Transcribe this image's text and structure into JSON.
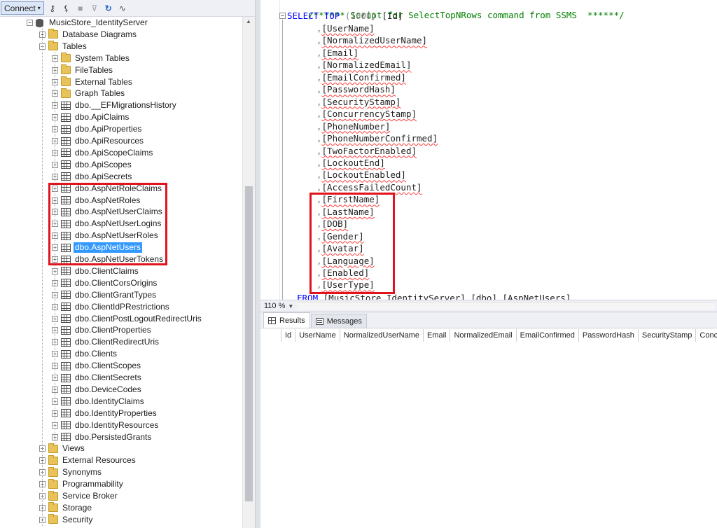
{
  "toolbar": {
    "connect_label": "Connect",
    "connect_arrow": "▾",
    "icons": [
      "connect-server-icon",
      "disconnect-icon",
      "stop-icon",
      "filter-icon",
      "refresh-icon",
      "activity-monitor-icon"
    ]
  },
  "tree": {
    "database": "MusicStore_IdentityServer",
    "folders_top": [
      {
        "label": "Database Diagrams",
        "expander": "+"
      },
      {
        "label": "Tables",
        "expander": "−"
      }
    ],
    "table_subfolders": [
      "System Tables",
      "FileTables",
      "External Tables",
      "Graph Tables"
    ],
    "tables": [
      "dbo.__EFMigrationsHistory",
      "dbo.ApiClaims",
      "dbo.ApiProperties",
      "dbo.ApiResources",
      "dbo.ApiScopeClaims",
      "dbo.ApiScopes",
      "dbo.ApiSecrets",
      "dbo.AspNetRoleClaims",
      "dbo.AspNetRoles",
      "dbo.AspNetUserClaims",
      "dbo.AspNetUserLogins",
      "dbo.AspNetUserRoles",
      "dbo.AspNetUsers",
      "dbo.AspNetUserTokens",
      "dbo.ClientClaims",
      "dbo.ClientCorsOrigins",
      "dbo.ClientGrantTypes",
      "dbo.ClientIdPRestrictions",
      "dbo.ClientPostLogoutRedirectUris",
      "dbo.ClientProperties",
      "dbo.ClientRedirectUris",
      "dbo.Clients",
      "dbo.ClientScopes",
      "dbo.ClientSecrets",
      "dbo.DeviceCodes",
      "dbo.IdentityClaims",
      "dbo.IdentityProperties",
      "dbo.IdentityResources",
      "dbo.PersistedGrants"
    ],
    "selected_table": "dbo.AspNetUsers",
    "folders_bottom": [
      "Views",
      "External Resources",
      "Synonyms",
      "Programmability",
      "Service Broker",
      "Storage",
      "Security"
    ]
  },
  "editor": {
    "comment_line": "/****** Script for SelectTopNRows command from SSMS  ******/",
    "select_kw": "SELECT",
    "top_kw": "TOP",
    "top_value": "(1000)",
    "first_column": "[Id]",
    "columns": [
      "[UserName]",
      "[NormalizedUserName]",
      "[Email]",
      "[NormalizedEmail]",
      "[EmailConfirmed]",
      "[PasswordHash]",
      "[SecurityStamp]",
      "[ConcurrencyStamp]",
      "[PhoneNumber]",
      "[PhoneNumberConfirmed]",
      "[TwoFactorEnabled]",
      "[LockoutEnd]",
      "[LockoutEnabled]",
      "[AccessFailedCount]",
      "[FirstName]",
      "[LastName]",
      "[DOB]",
      "[Gender]",
      "[Avatar]",
      "[Language]",
      "[Enabled]",
      "[UserType]"
    ],
    "from_kw": "FROM",
    "from_target": "[MusicStore_IdentityServer].[dbo].[AspNetUsers]"
  },
  "zoom": {
    "level": "110 %"
  },
  "results": {
    "tabs": [
      "Results",
      "Messages"
    ],
    "active_tab": "Results",
    "columns": [
      "Id",
      "UserName",
      "NormalizedUserName",
      "Email",
      "NormalizedEmail",
      "EmailConfirmed",
      "PasswordHash",
      "SecurityStamp",
      "Concurrenc"
    ]
  },
  "colors": {
    "highlight_border": "#e0141c",
    "selection": "#3399ff",
    "comment": "#008000",
    "keyword": "#0000ff"
  }
}
